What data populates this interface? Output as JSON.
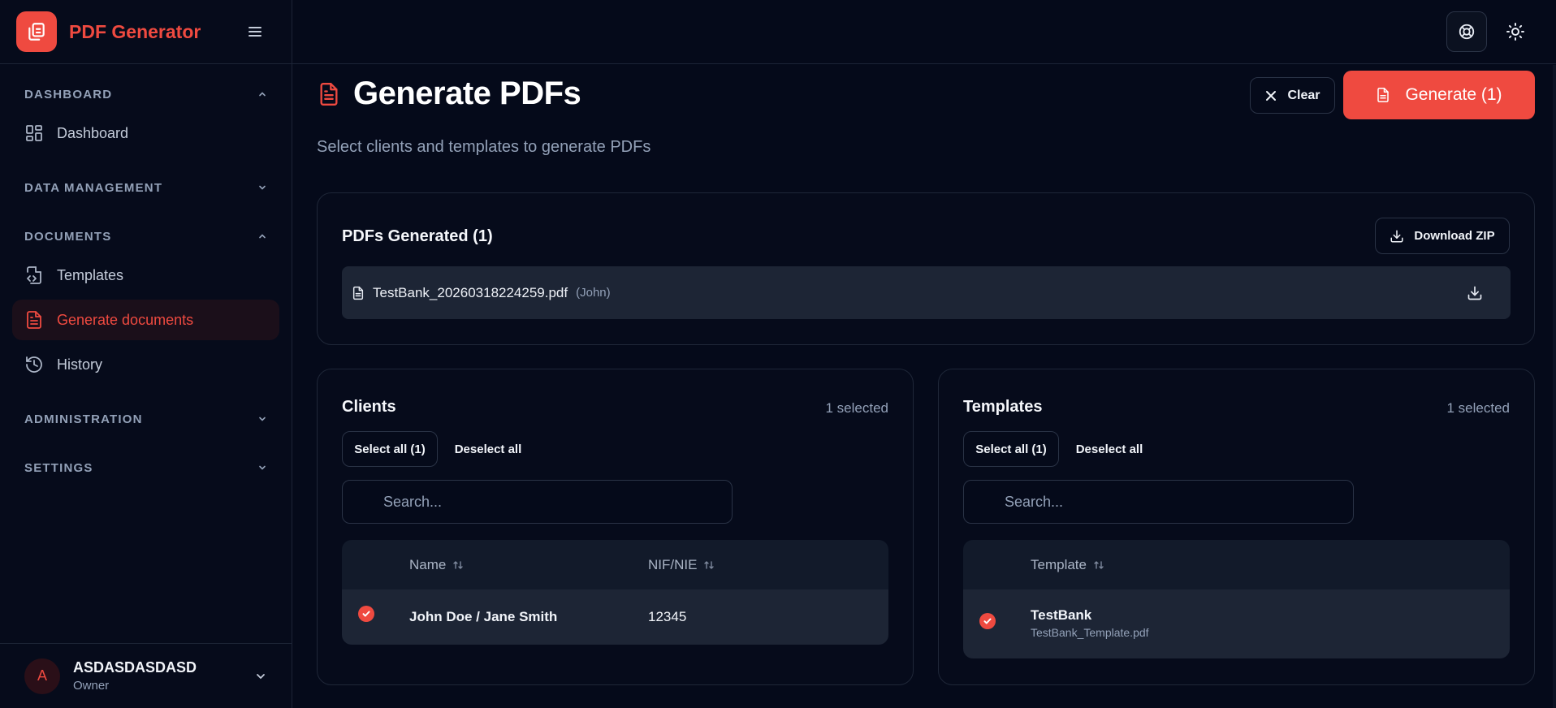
{
  "app": {
    "title": "PDF Generator"
  },
  "sidebar": {
    "sections": [
      {
        "label": "DASHBOARD",
        "expanded": true,
        "items": [
          {
            "label": "Dashboard",
            "icon": "dashboard-icon"
          }
        ]
      },
      {
        "label": "DATA MANAGEMENT",
        "expanded": false,
        "items": []
      },
      {
        "label": "DOCUMENTS",
        "expanded": true,
        "items": [
          {
            "label": "Templates",
            "icon": "file-code-icon"
          },
          {
            "label": "Generate documents",
            "icon": "file-text-icon",
            "active": true
          },
          {
            "label": "History",
            "icon": "history-icon"
          }
        ]
      },
      {
        "label": "ADMINISTRATION",
        "expanded": false,
        "items": []
      },
      {
        "label": "SETTINGS",
        "expanded": false,
        "items": []
      }
    ]
  },
  "user": {
    "initial": "A",
    "name": "ASDASDASDASD",
    "role": "Owner"
  },
  "page": {
    "title": "Generate PDFs",
    "subtitle": "Select clients and templates to generate PDFs",
    "clear_label": "Clear",
    "generate_label": "Generate (1)"
  },
  "generated": {
    "title": "PDFs Generated (1)",
    "download_zip_label": "Download ZIP",
    "files": [
      {
        "name": "TestBank_20260318224259.pdf",
        "owner": "(John)"
      }
    ]
  },
  "clients": {
    "title": "Clients",
    "selected": "1 selected",
    "select_all": "Select all (1)",
    "deselect_all": "Deselect all",
    "search_placeholder": "Search...",
    "columns": [
      "Name",
      "NIF/NIE"
    ],
    "rows": [
      {
        "name": "John Doe / Jane Smith",
        "nif": "12345",
        "checked": true
      }
    ]
  },
  "templates": {
    "title": "Templates",
    "selected": "1 selected",
    "select_all": "Select all (1)",
    "deselect_all": "Deselect all",
    "search_placeholder": "Search...",
    "columns": [
      "Template"
    ],
    "rows": [
      {
        "name": "TestBank",
        "file": "TestBank_Template.pdf",
        "checked": true
      }
    ]
  },
  "colors": {
    "accent": "#ef4a40",
    "background": "#050a1a",
    "muted": "#93a1b8",
    "row": "#1d2535"
  }
}
